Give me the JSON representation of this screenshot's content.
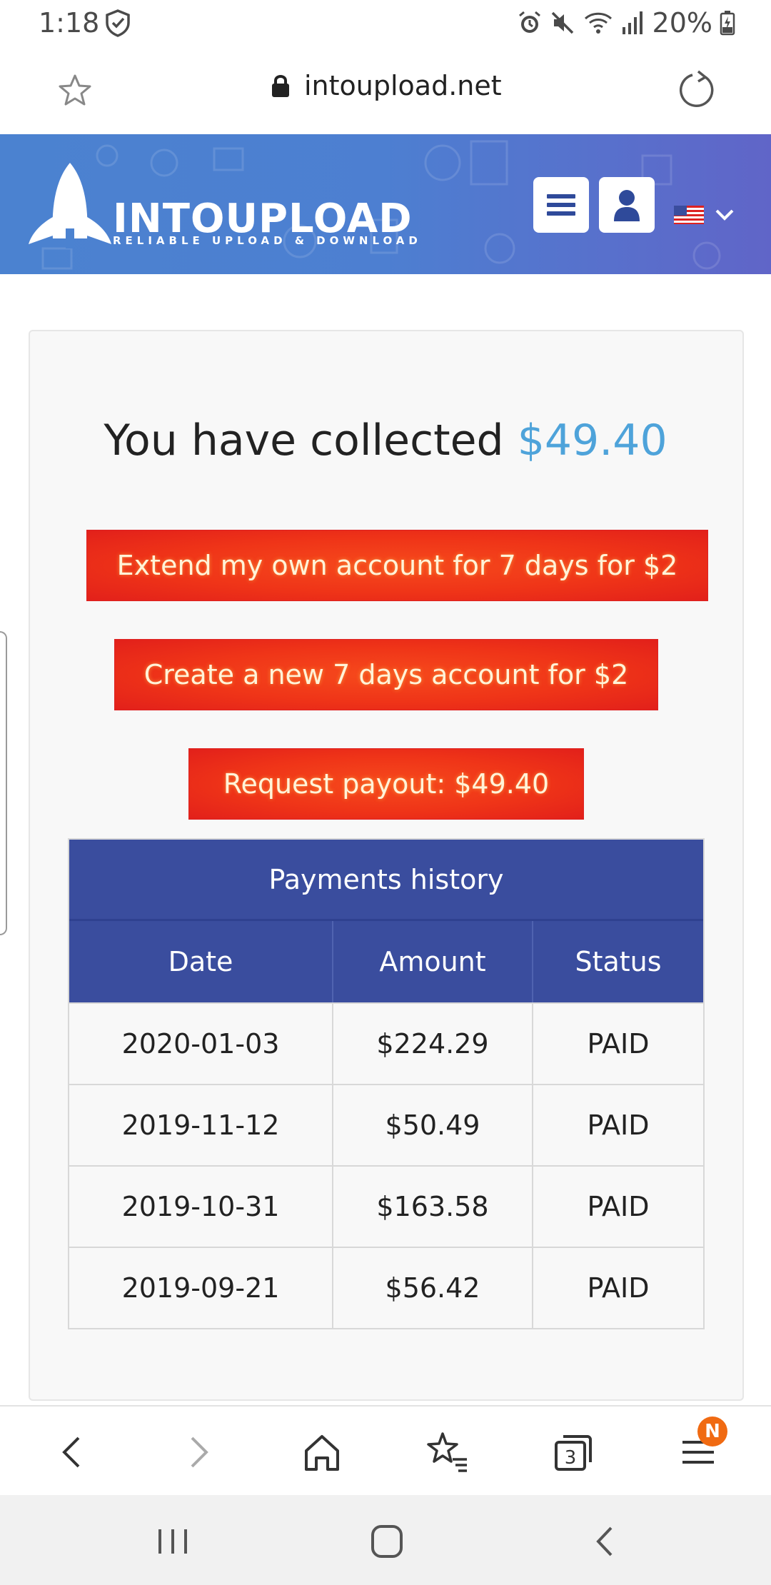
{
  "status_bar": {
    "time": "1:18",
    "battery_text": "20%",
    "icons": [
      "shield-check-icon",
      "alarm-icon",
      "mute-icon",
      "wifi-icon",
      "signal-icon",
      "battery-charging-icon"
    ]
  },
  "browser": {
    "url": "intoupload.net",
    "icons": [
      "bookmark-star-icon",
      "lock-icon",
      "reload-icon"
    ]
  },
  "site_header": {
    "logo_text": "INTOUPLOAD",
    "logo_tagline": "RELIABLE UPLOAD & DOWNLOAD",
    "icons": [
      "rocket-logo-icon",
      "hamburger-menu-icon",
      "user-icon",
      "us-flag-icon",
      "chevron-down-icon"
    ]
  },
  "main": {
    "headline_prefix": "You have collected ",
    "headline_amount": "$49.40",
    "buttons": {
      "extend": "Extend my own account for 7 days for $2",
      "create": "Create a new 7 days account for $2",
      "payout": "Request payout: $49.40"
    },
    "payments": {
      "title": "Payments history",
      "columns": [
        "Date",
        "Amount",
        "Status"
      ],
      "rows": [
        {
          "date": "2020-01-03",
          "amount": "$224.29",
          "status": "PAID"
        },
        {
          "date": "2019-11-12",
          "amount": "$50.49",
          "status": "PAID"
        },
        {
          "date": "2019-10-31",
          "amount": "$163.58",
          "status": "PAID"
        },
        {
          "date": "2019-09-21",
          "amount": "$56.42",
          "status": "PAID"
        }
      ]
    }
  },
  "toolbar": {
    "tabs_count": "3",
    "badge": "N",
    "icons": [
      "back-icon",
      "forward-icon",
      "home-icon",
      "bookmarks-icon",
      "tabs-icon",
      "menu-icon"
    ]
  },
  "colors": {
    "header_blue": "#4b82d0",
    "amount_blue": "#4ea3da",
    "button_red": "#ef3418",
    "table_header": "#3a4d9e",
    "badge_orange": "#f06a12"
  }
}
